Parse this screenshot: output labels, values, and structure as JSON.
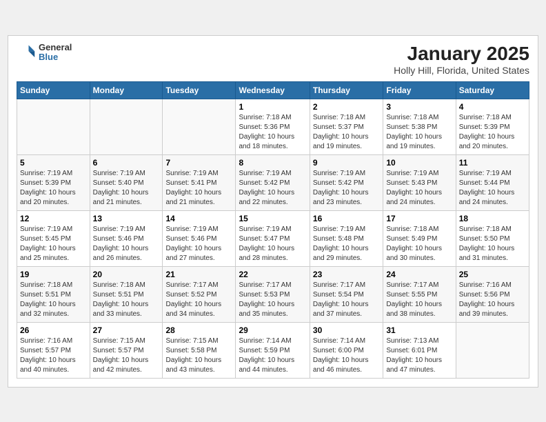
{
  "header": {
    "logo": {
      "line1": "General",
      "line2": "Blue"
    },
    "title": "January 2025",
    "subtitle": "Holly Hill, Florida, United States"
  },
  "weekdays": [
    "Sunday",
    "Monday",
    "Tuesday",
    "Wednesday",
    "Thursday",
    "Friday",
    "Saturday"
  ],
  "weeks": [
    [
      {
        "day": "",
        "info": ""
      },
      {
        "day": "",
        "info": ""
      },
      {
        "day": "",
        "info": ""
      },
      {
        "day": "1",
        "info": "Sunrise: 7:18 AM\nSunset: 5:36 PM\nDaylight: 10 hours\nand 18 minutes."
      },
      {
        "day": "2",
        "info": "Sunrise: 7:18 AM\nSunset: 5:37 PM\nDaylight: 10 hours\nand 19 minutes."
      },
      {
        "day": "3",
        "info": "Sunrise: 7:18 AM\nSunset: 5:38 PM\nDaylight: 10 hours\nand 19 minutes."
      },
      {
        "day": "4",
        "info": "Sunrise: 7:18 AM\nSunset: 5:39 PM\nDaylight: 10 hours\nand 20 minutes."
      }
    ],
    [
      {
        "day": "5",
        "info": "Sunrise: 7:19 AM\nSunset: 5:39 PM\nDaylight: 10 hours\nand 20 minutes."
      },
      {
        "day": "6",
        "info": "Sunrise: 7:19 AM\nSunset: 5:40 PM\nDaylight: 10 hours\nand 21 minutes."
      },
      {
        "day": "7",
        "info": "Sunrise: 7:19 AM\nSunset: 5:41 PM\nDaylight: 10 hours\nand 21 minutes."
      },
      {
        "day": "8",
        "info": "Sunrise: 7:19 AM\nSunset: 5:42 PM\nDaylight: 10 hours\nand 22 minutes."
      },
      {
        "day": "9",
        "info": "Sunrise: 7:19 AM\nSunset: 5:42 PM\nDaylight: 10 hours\nand 23 minutes."
      },
      {
        "day": "10",
        "info": "Sunrise: 7:19 AM\nSunset: 5:43 PM\nDaylight: 10 hours\nand 24 minutes."
      },
      {
        "day": "11",
        "info": "Sunrise: 7:19 AM\nSunset: 5:44 PM\nDaylight: 10 hours\nand 24 minutes."
      }
    ],
    [
      {
        "day": "12",
        "info": "Sunrise: 7:19 AM\nSunset: 5:45 PM\nDaylight: 10 hours\nand 25 minutes."
      },
      {
        "day": "13",
        "info": "Sunrise: 7:19 AM\nSunset: 5:46 PM\nDaylight: 10 hours\nand 26 minutes."
      },
      {
        "day": "14",
        "info": "Sunrise: 7:19 AM\nSunset: 5:46 PM\nDaylight: 10 hours\nand 27 minutes."
      },
      {
        "day": "15",
        "info": "Sunrise: 7:19 AM\nSunset: 5:47 PM\nDaylight: 10 hours\nand 28 minutes."
      },
      {
        "day": "16",
        "info": "Sunrise: 7:19 AM\nSunset: 5:48 PM\nDaylight: 10 hours\nand 29 minutes."
      },
      {
        "day": "17",
        "info": "Sunrise: 7:18 AM\nSunset: 5:49 PM\nDaylight: 10 hours\nand 30 minutes."
      },
      {
        "day": "18",
        "info": "Sunrise: 7:18 AM\nSunset: 5:50 PM\nDaylight: 10 hours\nand 31 minutes."
      }
    ],
    [
      {
        "day": "19",
        "info": "Sunrise: 7:18 AM\nSunset: 5:51 PM\nDaylight: 10 hours\nand 32 minutes."
      },
      {
        "day": "20",
        "info": "Sunrise: 7:18 AM\nSunset: 5:51 PM\nDaylight: 10 hours\nand 33 minutes."
      },
      {
        "day": "21",
        "info": "Sunrise: 7:17 AM\nSunset: 5:52 PM\nDaylight: 10 hours\nand 34 minutes."
      },
      {
        "day": "22",
        "info": "Sunrise: 7:17 AM\nSunset: 5:53 PM\nDaylight: 10 hours\nand 35 minutes."
      },
      {
        "day": "23",
        "info": "Sunrise: 7:17 AM\nSunset: 5:54 PM\nDaylight: 10 hours\nand 37 minutes."
      },
      {
        "day": "24",
        "info": "Sunrise: 7:17 AM\nSunset: 5:55 PM\nDaylight: 10 hours\nand 38 minutes."
      },
      {
        "day": "25",
        "info": "Sunrise: 7:16 AM\nSunset: 5:56 PM\nDaylight: 10 hours\nand 39 minutes."
      }
    ],
    [
      {
        "day": "26",
        "info": "Sunrise: 7:16 AM\nSunset: 5:57 PM\nDaylight: 10 hours\nand 40 minutes."
      },
      {
        "day": "27",
        "info": "Sunrise: 7:15 AM\nSunset: 5:57 PM\nDaylight: 10 hours\nand 42 minutes."
      },
      {
        "day": "28",
        "info": "Sunrise: 7:15 AM\nSunset: 5:58 PM\nDaylight: 10 hours\nand 43 minutes."
      },
      {
        "day": "29",
        "info": "Sunrise: 7:14 AM\nSunset: 5:59 PM\nDaylight: 10 hours\nand 44 minutes."
      },
      {
        "day": "30",
        "info": "Sunrise: 7:14 AM\nSunset: 6:00 PM\nDaylight: 10 hours\nand 46 minutes."
      },
      {
        "day": "31",
        "info": "Sunrise: 7:13 AM\nSunset: 6:01 PM\nDaylight: 10 hours\nand 47 minutes."
      },
      {
        "day": "",
        "info": ""
      }
    ]
  ]
}
